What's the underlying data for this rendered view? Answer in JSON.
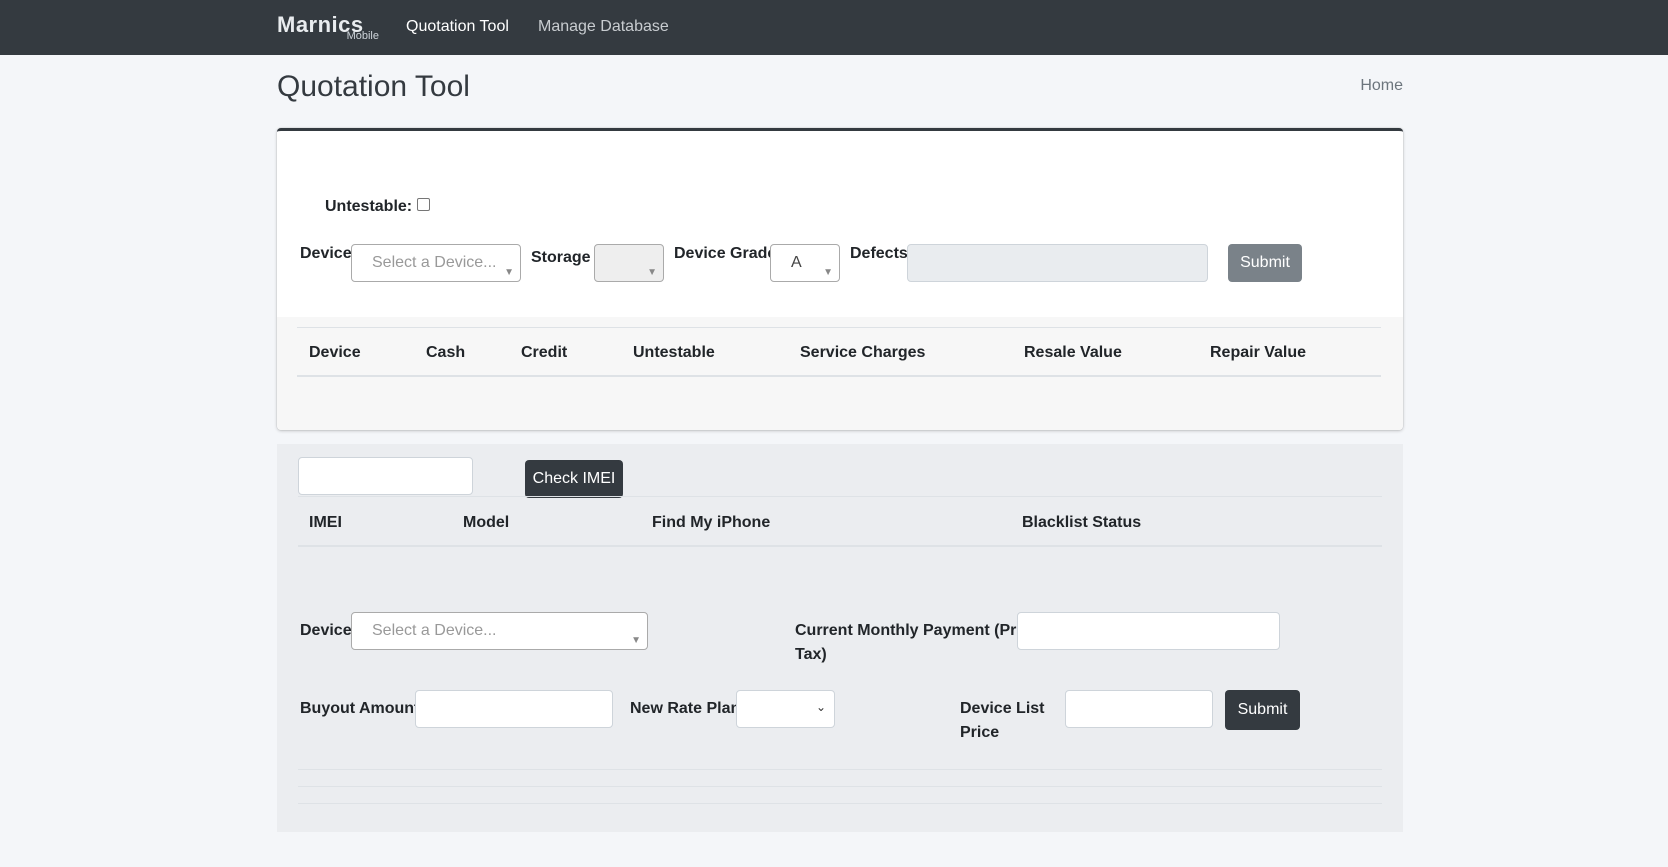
{
  "nav": {
    "brand_main": "Marnics",
    "brand_sub": "Mobile",
    "links": [
      {
        "label": "Quotation Tool",
        "active": true
      },
      {
        "label": "Manage Database",
        "active": false
      }
    ]
  },
  "header": {
    "title": "Quotation Tool",
    "breadcrumb": "Home"
  },
  "quote_form": {
    "untestable_label": "Untestable:",
    "device_label": "Device",
    "device_placeholder": "Select a Device...",
    "storage_label": "Storage",
    "storage_value": "",
    "grade_label": "Device Grade",
    "grade_value": "A",
    "defects_label": "Defects",
    "submit_label": "Submit"
  },
  "quote_table": {
    "columns": [
      "Device",
      "Cash",
      "Credit",
      "Untestable",
      "Service Charges",
      "Resale Value",
      "Repair Value"
    ],
    "rows": []
  },
  "imei": {
    "input_value": "",
    "check_label": "Check IMEI",
    "columns": [
      "IMEI",
      "Model",
      "Find My iPhone",
      "Blacklist Status"
    ],
    "rows": []
  },
  "buyout_form": {
    "device_label": "Device",
    "device_placeholder": "Select a Device...",
    "monthly_payment_label_line1": "Current Monthly Payment (Pre",
    "monthly_payment_label_line2": "Tax)",
    "buyout_label": "Buyout Amount",
    "rate_plan_label": "New Rate Plan",
    "list_price_label_line1": "Device List",
    "list_price_label_line2": "Price",
    "submit_label": "Submit"
  },
  "icons": {
    "dropdown": "▼",
    "native_dropdown": "⌄"
  },
  "colors": {
    "navbar": "#343a40",
    "page_bg": "#f4f6f9",
    "primary_dark": "#343a40",
    "secondary": "#6c757d"
  }
}
